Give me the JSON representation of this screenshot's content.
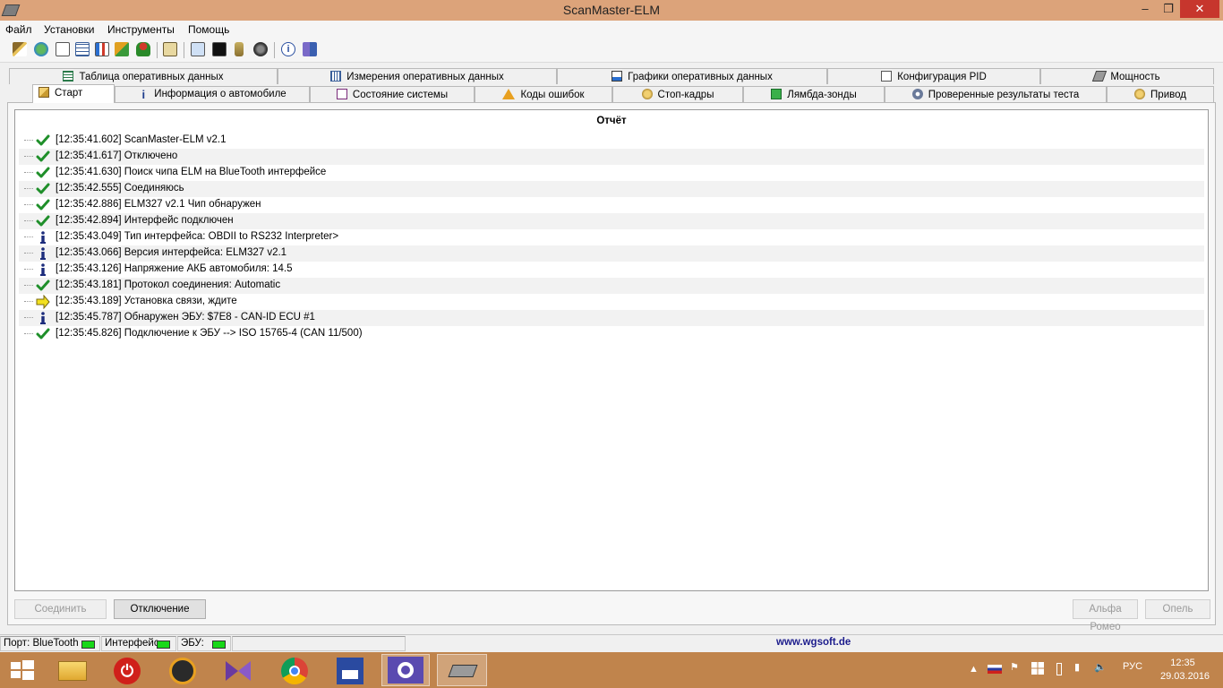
{
  "window": {
    "title": "ScanMaster-ELM",
    "minimize": "–",
    "maximize": "❐",
    "close": "✕"
  },
  "menu": [
    "Файл",
    "Установки",
    "Инструменты",
    "Помощь"
  ],
  "toolbar_icons": [
    "wand-icon",
    "globe-icon",
    "document-icon",
    "table-icon",
    "chart-icon",
    "map-icon",
    "gauge-icon",
    "clipboard-icon",
    "monitor-icon",
    "terminal-icon",
    "battery-icon",
    "speaker-icon",
    "info-icon",
    "book-icon"
  ],
  "tabs_row1": [
    {
      "label": "Таблица оперативных данных",
      "icon": "table-icon"
    },
    {
      "label": "Измерения оперативных данных",
      "icon": "grid-icon"
    },
    {
      "label": "Графики оперативных данных",
      "icon": "chart-icon"
    },
    {
      "label": "Конфигурация PID",
      "icon": "document-icon"
    },
    {
      "label": "Мощность",
      "icon": "engine-icon"
    }
  ],
  "tabs_row2": [
    {
      "label": "Старт",
      "icon": "box-icon",
      "active": true
    },
    {
      "label": "Информация о автомобиле",
      "icon": "info-icon"
    },
    {
      "label": "Состояние системы",
      "icon": "checklist-icon"
    },
    {
      "label": "Коды ошибок",
      "icon": "warning-icon"
    },
    {
      "label": "Стоп-кадры",
      "icon": "snapshot-icon"
    },
    {
      "label": "Лямбда-зонды",
      "icon": "sensor-icon"
    },
    {
      "label": "Проверенные результаты теста",
      "icon": "gear-icon"
    },
    {
      "label": "Привод",
      "icon": "drive-icon"
    }
  ],
  "report": {
    "header": "Отчёт",
    "rows": [
      {
        "icon": "check",
        "text": "[12:35:41.602] ScanMaster-ELM v2.1"
      },
      {
        "icon": "check",
        "text": "[12:35:41.617] Отключено"
      },
      {
        "icon": "check",
        "text": "[12:35:41.630] Поиск чипа ELM на BlueTooth интерфейсе"
      },
      {
        "icon": "check",
        "text": "[12:35:42.555] Соединяюсь"
      },
      {
        "icon": "check",
        "text": "[12:35:42.886] ELM327 v2.1 Чип обнаружен"
      },
      {
        "icon": "check",
        "text": "[12:35:42.894] Интерфейс подключен"
      },
      {
        "icon": "info",
        "text": "[12:35:43.049] Тип интерфейса: OBDII to RS232 Interpreter>"
      },
      {
        "icon": "info",
        "text": "[12:35:43.066] Версия интерфейса: ELM327 v2.1"
      },
      {
        "icon": "info",
        "text": "[12:35:43.126] Напряжение АКБ автомобиля: 14.5"
      },
      {
        "icon": "check",
        "text": "[12:35:43.181] Протокол соединения: Automatic"
      },
      {
        "icon": "arrow",
        "text": "[12:35:43.189] Установка связи, ждите"
      },
      {
        "icon": "info",
        "text": "[12:35:45.787] Обнаружен ЭБУ: $7E8 - CAN-ID ECU #1"
      },
      {
        "icon": "check",
        "text": "[12:35:45.826] Подключение к ЭБУ --> ISO 15765-4 (CAN 11/500)"
      }
    ]
  },
  "buttons": {
    "connect": "Соединить",
    "disconnect": "Отключение",
    "alfa": "Альфа Ромео",
    "opel": "Опель"
  },
  "status": {
    "port": "Порт: BlueTooth",
    "interface": "Интерфейс",
    "ecu": "ЭБУ:",
    "website": "www.wgsoft.de",
    "led_color": "#18d818"
  },
  "taskbar": {
    "lang": "РУС",
    "time": "12:35",
    "date": "29.03.2016",
    "apps": [
      "windows-start-icon",
      "file-explorer-icon",
      "power-icon",
      "app-triangle-icon",
      "visual-studio-icon",
      "chrome-icon",
      "floppy-save-icon",
      "settings-gear-icon",
      "scanmaster-icon"
    ]
  }
}
